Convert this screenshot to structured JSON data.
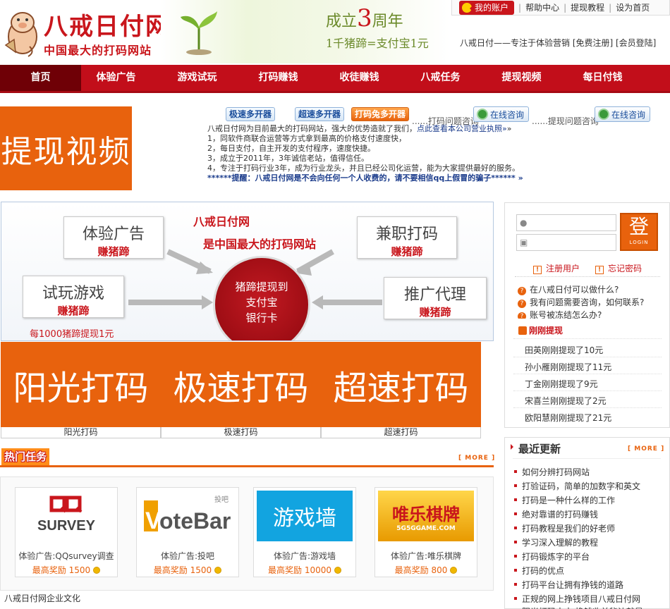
{
  "header": {
    "logo_text": "八戒日付网",
    "logo_subtitle": "中国最大的打码网站",
    "anniversary_prefix": "成立",
    "anniversary_number": "3",
    "anniversary_suffix": "周年",
    "exchange_rate": "1千猪蹄=支付宝1元",
    "top_links": [
      "我的账户",
      "帮助中心",
      "提现教程",
      "设为首页"
    ],
    "slogan": "八戒日付——专注于体验营销  [免费注册]  [会员登陆]"
  },
  "nav": {
    "items": [
      "首页",
      "体验广告",
      "游戏试玩",
      "打码赚钱",
      "收徒赚钱",
      "八戒任务",
      "提现视频",
      "每日付钱"
    ]
  },
  "intro": {
    "withdraw_video": "提现视频",
    "buttons": [
      "极速多开器",
      "超速多开器",
      "打码兔多开器"
    ],
    "consult_label": "打码问题咨询",
    "consult_button": "在线咨询",
    "consult_label2": "提现问题咨询",
    "consult_button2": "在线咨询",
    "dots": "......",
    "desc_main": "八戒日付网为目前最大的打码网站，强大的优势造就了我们，",
    "desc_link": "点此查看本公司营业执照»",
    "desc_arrow": "»",
    "points": [
      "1，同软件商联合运营等方式拿到最高的价格支付速度快，",
      "2，每日支付，自主开发的支付程序，速度快捷。",
      "3，成立于2011年，3年诚信老站，值得信任。",
      "4，专注于打码行业3年，成为行业龙头，并且已经公司化运营，能为大家提供最好的服务。"
    ],
    "warning": "******提醒：八戒日付网是不会向任何一个人收费的，请不要相信qq上假冒的骗子****** »"
  },
  "promo": {
    "title1": "八戒日付网",
    "title2": "是中国最大的打码网站",
    "boxes": [
      {
        "title": "体验广告",
        "sub": "赚猪蹄"
      },
      {
        "title": "兼职打码",
        "sub": "赚猪蹄"
      },
      {
        "title": "试玩游戏",
        "sub": "赚猪蹄"
      },
      {
        "title": "推广代理",
        "sub": "赚猪蹄"
      }
    ],
    "circle_lines": [
      "猪蹄提现到",
      "支付宝",
      "银行卡"
    ],
    "footer": "每1000猪蹄提现1元"
  },
  "tiles": [
    {
      "title": "阳光打码",
      "caption": "阳光打码"
    },
    {
      "title": "极速打码",
      "caption": "极速打码"
    },
    {
      "title": "超速打码",
      "caption": "超速打码"
    }
  ],
  "hot_tasks": {
    "title": "热门任务",
    "more": "[ MORE ]",
    "items": [
      {
        "logo": "QQ SURVEY",
        "name": "体验广告:QQsurvey调查",
        "reward_label": "最高奖励",
        "reward": "1500"
      },
      {
        "logo": "VoteBar",
        "name": "体验广告:投吧",
        "reward_label": "最高奖励",
        "reward": "1500"
      },
      {
        "logo": "游戏墙",
        "name": "体验广告:游戏墙",
        "reward_label": "最高奖励",
        "reward": "10000"
      },
      {
        "logo": "唯乐棋牌",
        "name": "体验广告:唯乐棋牌",
        "reward_label": "最高奖励",
        "reward": "800"
      }
    ],
    "votebar_tag": "投吧",
    "weile_sub": "5G5GGAME.COM"
  },
  "culture": "八戒日付网企业文化",
  "login": {
    "button": "登",
    "button_sub": "LOGIN",
    "register": "注册用户",
    "forgot": "忘记密码",
    "faqs": [
      "在八戒日付可以做什么?",
      "我有问题需要咨询，如何联系?",
      "账号被冻结怎么办?"
    ]
  },
  "just_withdraw": {
    "title": "刚刚提现",
    "items": [
      "田英刚刚提现了10元",
      "孙小雁刚刚提现了11元",
      "丁金刚刚提现了9元",
      "宋喜兰刚刚提现了2元",
      "欧阳慧刚刚提现了21元"
    ]
  },
  "recent": {
    "title": "最近更新",
    "more": "[ MORE ]",
    "items": [
      "如何分辨打码网站",
      "打验证码，简单的加数字和英文",
      "打码是一种什么样的工作",
      "绝对靠谱的打码赚钱",
      "打码教程是我们的好老师",
      "学习深入理解的教程",
      "打码锻炼字的平台",
      "打码的优点",
      "打码平台让拥有挣钱的道路",
      "正规的网上挣钱项目八戒日付网",
      "阳光打码中中 挣钱收益秘诀就是"
    ]
  },
  "colors": {
    "brand_red": "#c20e1a",
    "accent_orange": "#e8620d"
  }
}
